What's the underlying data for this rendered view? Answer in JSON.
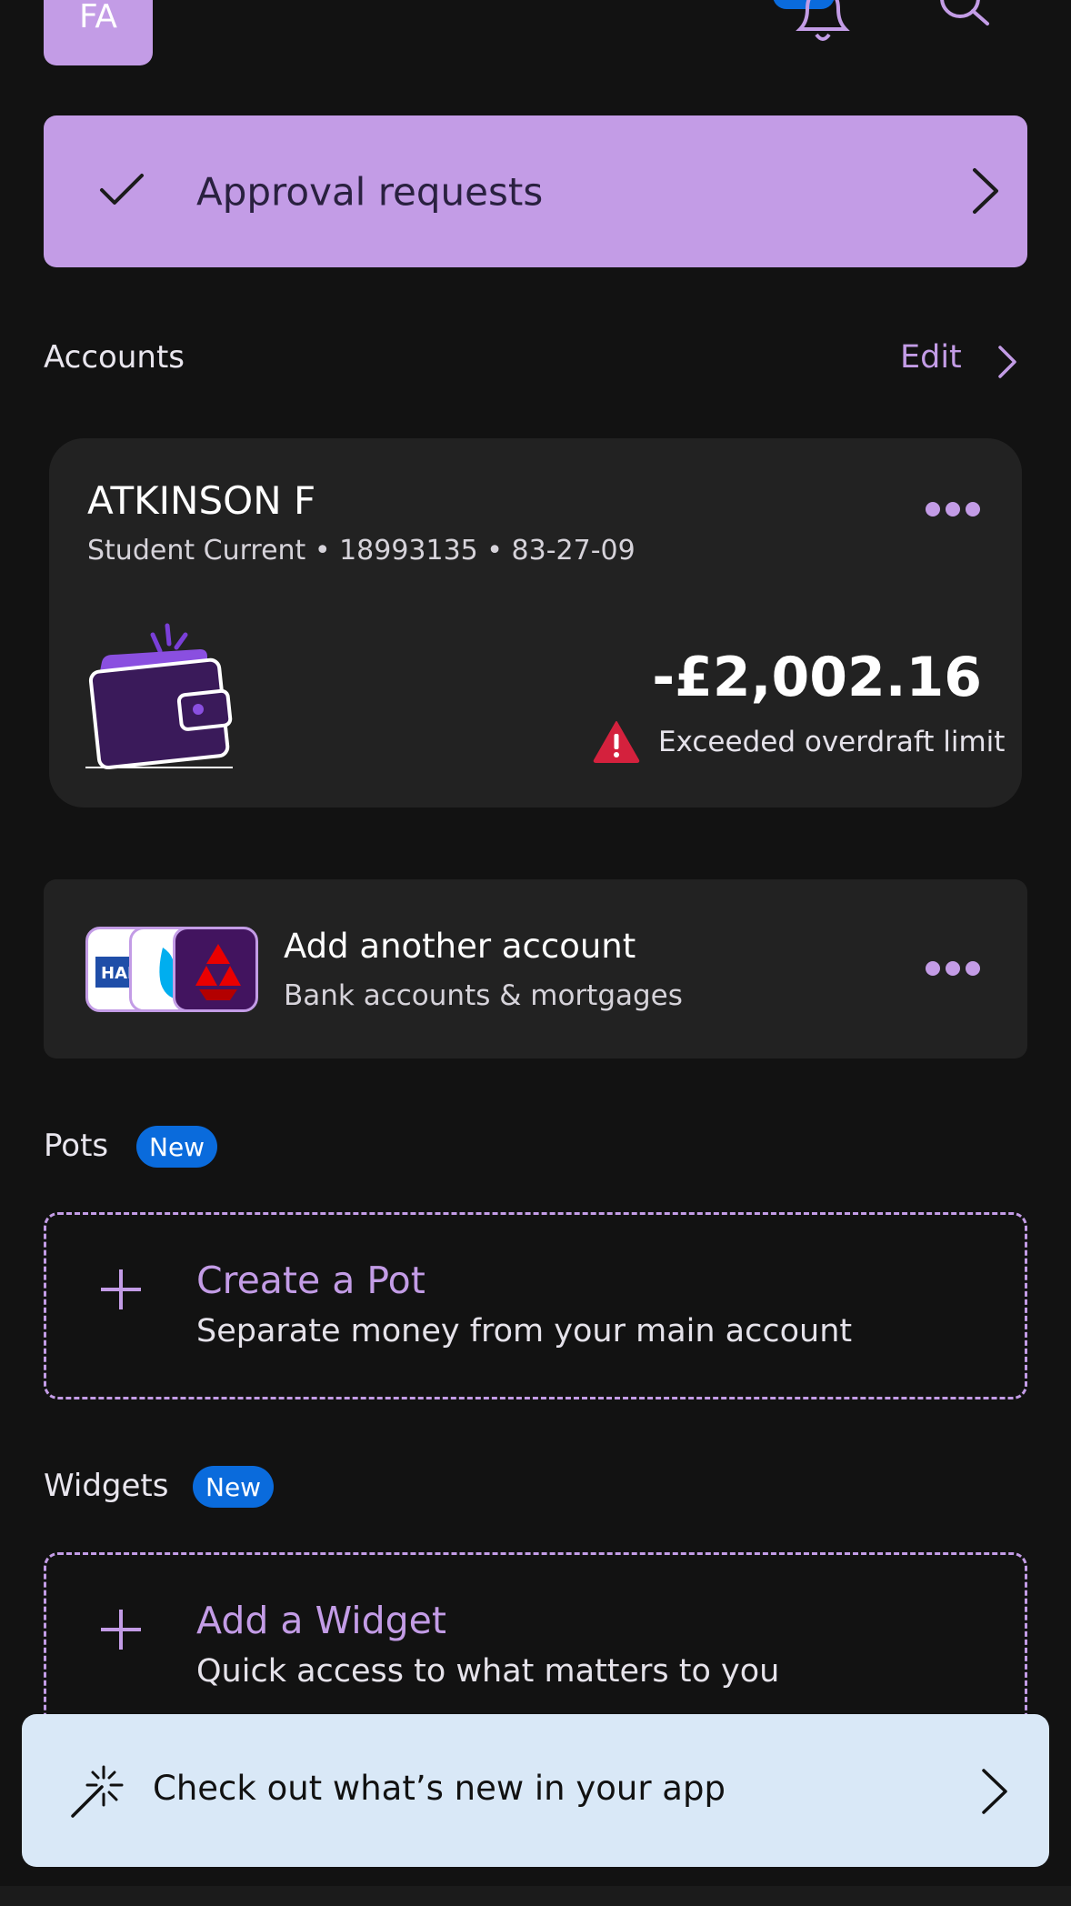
{
  "header": {
    "avatar_initials": "FA"
  },
  "approval": {
    "label": "Approval requests"
  },
  "accounts": {
    "title": "Accounts",
    "edit_label": "Edit",
    "card": {
      "holder": "ATKINSON F",
      "meta": "Student Current • 18993135 • 83-27-09",
      "balance": "-£2,002.16",
      "warning": "Exceeded overdraft limit"
    },
    "add": {
      "title": "Add another account",
      "subtitle": "Bank accounts & mortgages",
      "logo_text": "HAL"
    }
  },
  "pots": {
    "title": "Pots",
    "badge": "New",
    "create_title": "Create a Pot",
    "create_subtitle": "Separate money from your main account"
  },
  "widgets": {
    "title": "Widgets",
    "badge": "New",
    "add_title": "Add a Widget",
    "add_subtitle": "Quick access to what matters to you"
  },
  "banner": {
    "label": "Check out what’s new in your app"
  },
  "colors": {
    "background": "#121212",
    "accent": "#c39ce6",
    "card": "#222222",
    "badge_blue": "#0a6bdc",
    "warning_red": "#d4213d",
    "banner_bg": "#d9e8f7"
  }
}
